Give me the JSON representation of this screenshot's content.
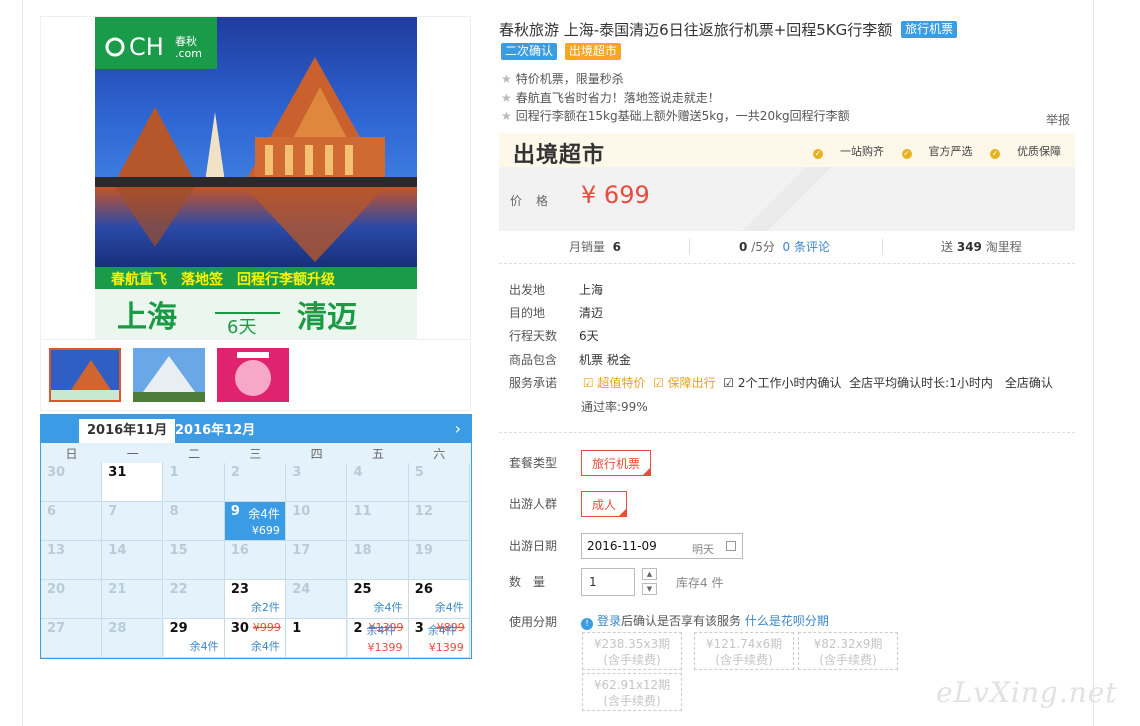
{
  "product": {
    "title": "春秋旅游 上海-泰国清迈6日往返旅行机票+回程5KG行李额",
    "title_tag": "旅行机票",
    "tags": [
      "二次确认",
      "出境超市"
    ],
    "features": [
      "特价机票，限量秒杀",
      "春航直飞省时省力！落地签说走就走！",
      "回程行李额在15kg基础上额外赠送5kg，一共20kg回程行李额"
    ],
    "report": "举报"
  },
  "image": {
    "logo_text": "CH",
    "logo_sub": "春秋",
    "logo_domain": ".com",
    "banner_line1": "春航直飞　落地签　回程行李额升级",
    "from": "上海",
    "duration": "6天",
    "to": "清迈"
  },
  "market": {
    "logo": "出境超市",
    "badges": [
      "一站购齐",
      "官方严选",
      "优质保障"
    ]
  },
  "price": {
    "label": "价格",
    "currency": "¥",
    "value": "699"
  },
  "stats": {
    "monthly_sales_label": "月销量",
    "monthly_sales": "6",
    "rating": "0",
    "rating_of": "/5分",
    "reviews": "0 条评论",
    "points_prefix": "送",
    "points": "349",
    "points_suffix": "淘里程"
  },
  "info": {
    "departure_label": "出发地",
    "departure": "上海",
    "destination_label": "目的地",
    "destination": "清迈",
    "days_label": "行程天数",
    "days": "6天",
    "includes_label": "商品包含",
    "includes": "机票  税金",
    "promise_label": "服务承诺",
    "promises": [
      "超值特价",
      "保障出行",
      "2个工作小时内确认"
    ],
    "promise_rest": "全店平均确认时长:1小时内　全店确认",
    "promise_rest2": "通过率:99%"
  },
  "options": {
    "package_label": "套餐类型",
    "package_value": "旅行机票",
    "group_label": "出游人群",
    "group_value": "成人",
    "date_label": "出游日期",
    "date_value": "2016-11-09",
    "date_hint": "明天",
    "qty_label": "数　量",
    "qty_value": "1",
    "stock": "库存4 件",
    "installment_label": "使用分期",
    "installment_link1": "登录",
    "installment_text": "后确认是否享有该服务",
    "installment_link2": "什么是花呗分期",
    "plans": [
      {
        "amount": "¥238.35",
        "periods": "x3期",
        "fee": "(含手续费)"
      },
      {
        "amount": "¥121.74",
        "periods": "x6期",
        "fee": "(含手续费)"
      },
      {
        "amount": "¥82.32",
        "periods": "x9期",
        "fee": "(含手续费)"
      },
      {
        "amount": "¥62.91",
        "periods": "x12期",
        "fee": "(含手续费)"
      }
    ]
  },
  "calendar": {
    "month_active": "2016年11月",
    "month_next": "2016年12月",
    "weekdays": [
      "日",
      "一",
      "二",
      "三",
      "四",
      "五",
      "六"
    ],
    "rows": [
      [
        {
          "d": "30"
        },
        {
          "d": "31",
          "w": true
        },
        {
          "d": "1"
        },
        {
          "d": "2"
        },
        {
          "d": "3"
        },
        {
          "d": "4"
        },
        {
          "d": "5"
        }
      ],
      [
        {
          "d": "6"
        },
        {
          "d": "7"
        },
        {
          "d": "8"
        },
        {
          "d": "9",
          "sel": true,
          "stock": "余4件",
          "price": "¥699"
        },
        {
          "d": "10"
        },
        {
          "d": "11"
        },
        {
          "d": "12"
        }
      ],
      [
        {
          "d": "13"
        },
        {
          "d": "14"
        },
        {
          "d": "15"
        },
        {
          "d": "16"
        },
        {
          "d": "17"
        },
        {
          "d": "18"
        },
        {
          "d": "19"
        }
      ],
      [
        {
          "d": "20"
        },
        {
          "d": "21"
        },
        {
          "d": "22"
        },
        {
          "d": "23",
          "w": true,
          "stock": "余2件"
        },
        {
          "d": "24"
        },
        {
          "d": "25",
          "w": true,
          "stock": "余4件"
        },
        {
          "d": "26",
          "w": true,
          "stock": "余4件"
        }
      ],
      [
        {
          "d": "27"
        },
        {
          "d": "28"
        },
        {
          "d": "29",
          "w": true,
          "stock": "余4件"
        },
        {
          "d": "30",
          "w": true,
          "old": "¥999",
          "stock": "余4件"
        },
        {
          "d": "1",
          "w": true
        },
        {
          "d": "2",
          "w": true,
          "old": "¥1399",
          "price": "¥1399",
          "stock2": "余4件"
        },
        {
          "d": "3",
          "w": true,
          "old": "¥899",
          "price": "¥1399",
          "stock2": "余4件"
        }
      ]
    ]
  },
  "watermark": "eLvXing.net"
}
